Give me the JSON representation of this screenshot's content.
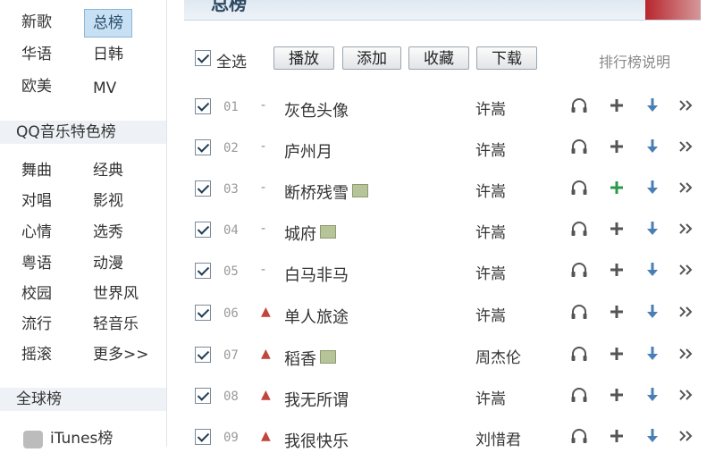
{
  "sidebar": {
    "categories": [
      {
        "label": "新歌",
        "active": false
      },
      {
        "label": "总榜",
        "active": true
      },
      {
        "label": "华语",
        "active": false
      },
      {
        "label": "日韩",
        "active": false
      },
      {
        "label": "欧美",
        "active": false
      },
      {
        "label": "MV",
        "active": false
      }
    ],
    "special_header": "QQ音乐特色榜",
    "special_items": [
      "舞曲",
      "经典",
      "对唱",
      "影视",
      "心情",
      "选秀",
      "粤语",
      "动漫",
      "校园",
      "世界风",
      "流行",
      "轻音乐",
      "摇滚",
      "更多>>"
    ],
    "global_header": "全球榜",
    "global_items": [
      "iTunes榜"
    ]
  },
  "banner": {
    "title": "总榜"
  },
  "toolbar": {
    "select_all": "全选",
    "play": "播放",
    "add": "添加",
    "favorite": "收藏",
    "download": "下载",
    "explain": "排行榜说明"
  },
  "colors": {
    "accent": "#2b9a4a",
    "download": "#4a7fb5",
    "active_bg": "#c7e0f3"
  },
  "songs": [
    {
      "rank": "01",
      "trend": "-",
      "title": "灰色头像",
      "singer": "许嵩",
      "mv": false
    },
    {
      "rank": "02",
      "trend": "-",
      "title": "庐州月",
      "singer": "许嵩",
      "mv": false
    },
    {
      "rank": "03",
      "trend": "-",
      "title": "断桥残雪",
      "singer": "许嵩",
      "mv": true
    },
    {
      "rank": "04",
      "trend": "-",
      "title": "城府",
      "singer": "许嵩",
      "mv": true
    },
    {
      "rank": "05",
      "trend": "-",
      "title": "白马非马",
      "singer": "许嵩",
      "mv": false
    },
    {
      "rank": "06",
      "trend": "▲",
      "title": "单人旅途",
      "singer": "许嵩",
      "mv": false
    },
    {
      "rank": "07",
      "trend": "▲",
      "title": "稻香",
      "singer": "周杰伦",
      "mv": true
    },
    {
      "rank": "08",
      "trend": "▲",
      "title": "我无所谓",
      "singer": "许嵩",
      "mv": false
    },
    {
      "rank": "09",
      "trend": "▲",
      "title": "我很快乐",
      "singer": "刘惜君",
      "mv": false
    }
  ],
  "actions": [
    "headphones-icon",
    "add-icon",
    "download-arrow-icon",
    "more-icon"
  ]
}
